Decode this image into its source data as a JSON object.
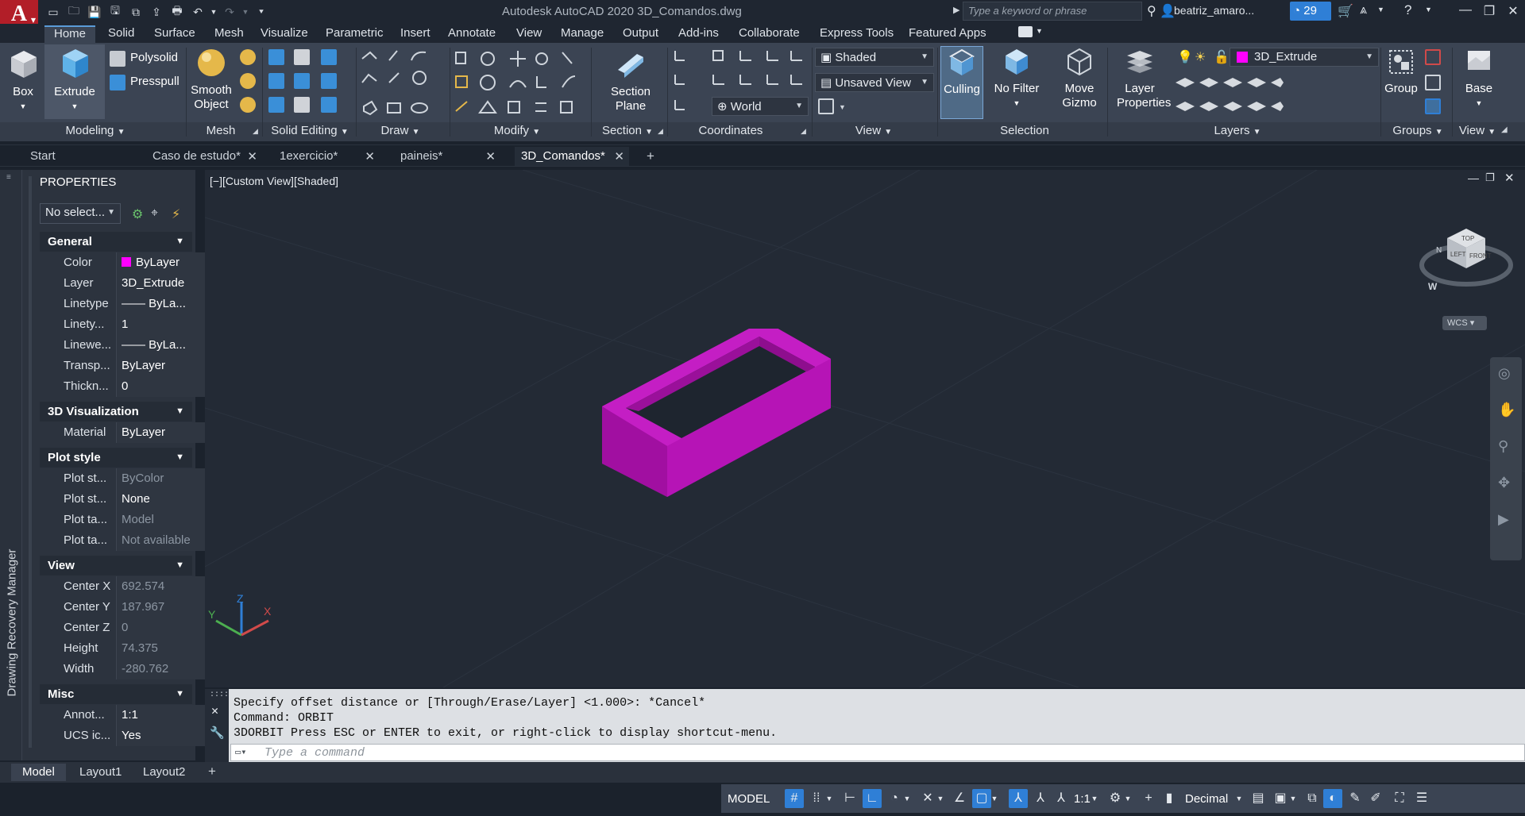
{
  "app": {
    "logo_letter": "A",
    "window_title": "Autodesk AutoCAD 2020    3D_Comandos.dwg",
    "search_placeholder": "Type a keyword or phrase",
    "user": "beatriz_amaro...",
    "tray_count": "29"
  },
  "ribbon_tabs": [
    "Home",
    "Solid",
    "Surface",
    "Mesh",
    "Visualize",
    "Parametric",
    "Insert",
    "Annotate",
    "View",
    "Manage",
    "Output",
    "Add-ins",
    "Collaborate",
    "Express Tools",
    "Featured Apps"
  ],
  "panels": {
    "modeling": {
      "label": "Modeling",
      "box": "Box",
      "extrude": "Extrude",
      "polysolid": "Polysolid",
      "presspull": "Presspull"
    },
    "mesh": {
      "label": "Mesh",
      "smooth_object": "Smooth Object"
    },
    "solid_editing": {
      "label": "Solid Editing"
    },
    "draw": {
      "label": "Draw"
    },
    "modify": {
      "label": "Modify"
    },
    "section": {
      "label": "Section",
      "section_plane": "Section Plane"
    },
    "coordinates": {
      "label": "Coordinates",
      "world": "World"
    },
    "view": {
      "label": "View",
      "visual_style": "Shaded",
      "named_view": "Unsaved View"
    },
    "selection": {
      "label": "Selection",
      "culling": "Culling",
      "no_filter": "No Filter",
      "move_gizmo": "Move Gizmo"
    },
    "layers": {
      "label": "Layers",
      "layer_properties": "Layer Properties",
      "current_layer": "3D_Extrude"
    },
    "groups": {
      "label": "Groups",
      "group": "Group"
    },
    "view2": {
      "label": "View",
      "base": "Base"
    }
  },
  "doc_tabs": [
    {
      "label": "Start"
    },
    {
      "label": "Caso de estudo*"
    },
    {
      "label": "1exercicio*"
    },
    {
      "label": "paineis*"
    },
    {
      "label": "3D_Comandos*"
    }
  ],
  "left_strip_label": "Drawing Recovery Manager",
  "properties": {
    "title": "PROPERTIES",
    "selection": "No select...",
    "sections": {
      "general": "General",
      "vis3d": "3D Visualization",
      "plot": "Plot style",
      "view": "View",
      "misc": "Misc"
    },
    "general": [
      {
        "k": "Color",
        "v": "ByLayer"
      },
      {
        "k": "Layer",
        "v": "3D_Extrude"
      },
      {
        "k": "Linetype",
        "v": "—— ByLa..."
      },
      {
        "k": "Linety...",
        "v": "1"
      },
      {
        "k": "Linewe...",
        "v": "—— ByLa..."
      },
      {
        "k": "Transp...",
        "v": "ByLayer"
      },
      {
        "k": "Thickn...",
        "v": "0"
      }
    ],
    "vis3d": [
      {
        "k": "Material",
        "v": "ByLayer"
      }
    ],
    "plot": [
      {
        "k": "Plot st...",
        "v": "ByColor"
      },
      {
        "k": "Plot st...",
        "v": "None"
      },
      {
        "k": "Plot ta...",
        "v": "Model"
      },
      {
        "k": "Plot ta...",
        "v": "Not available"
      }
    ],
    "view": [
      {
        "k": "Center X",
        "v": "692.574"
      },
      {
        "k": "Center Y",
        "v": "187.967"
      },
      {
        "k": "Center Z",
        "v": "0"
      },
      {
        "k": "Height",
        "v": "74.375"
      },
      {
        "k": "Width",
        "v": "-280.762"
      }
    ],
    "misc": [
      {
        "k": "Annot...",
        "v": "1:1"
      },
      {
        "k": "UCS ic...",
        "v": "Yes"
      }
    ]
  },
  "viewport": {
    "label": "[−][Custom View][Shaded]",
    "viewcube": {
      "top": "TOP",
      "left": "LEFT",
      "front": "FRONT",
      "n": "N",
      "w": "W",
      "wcs": "WCS"
    },
    "ucs": {
      "x": "X",
      "y": "Y",
      "z": "Z"
    }
  },
  "command": {
    "history": [
      "Specify offset distance or [Through/Erase/Layer] <1.000>: *Cancel*",
      "Command: ORBIT",
      "3DORBIT Press ESC or ENTER to exit, or right-click to display shortcut-menu."
    ],
    "placeholder": "Type a command"
  },
  "layout_tabs": [
    "Model",
    "Layout1",
    "Layout2"
  ],
  "status": {
    "model": "MODEL",
    "scale": "1:1",
    "units": "Decimal"
  },
  "colors": {
    "accent": "#2f7fd6",
    "solid": "#c21fc2",
    "ribbon_bg": "#3b4453"
  }
}
